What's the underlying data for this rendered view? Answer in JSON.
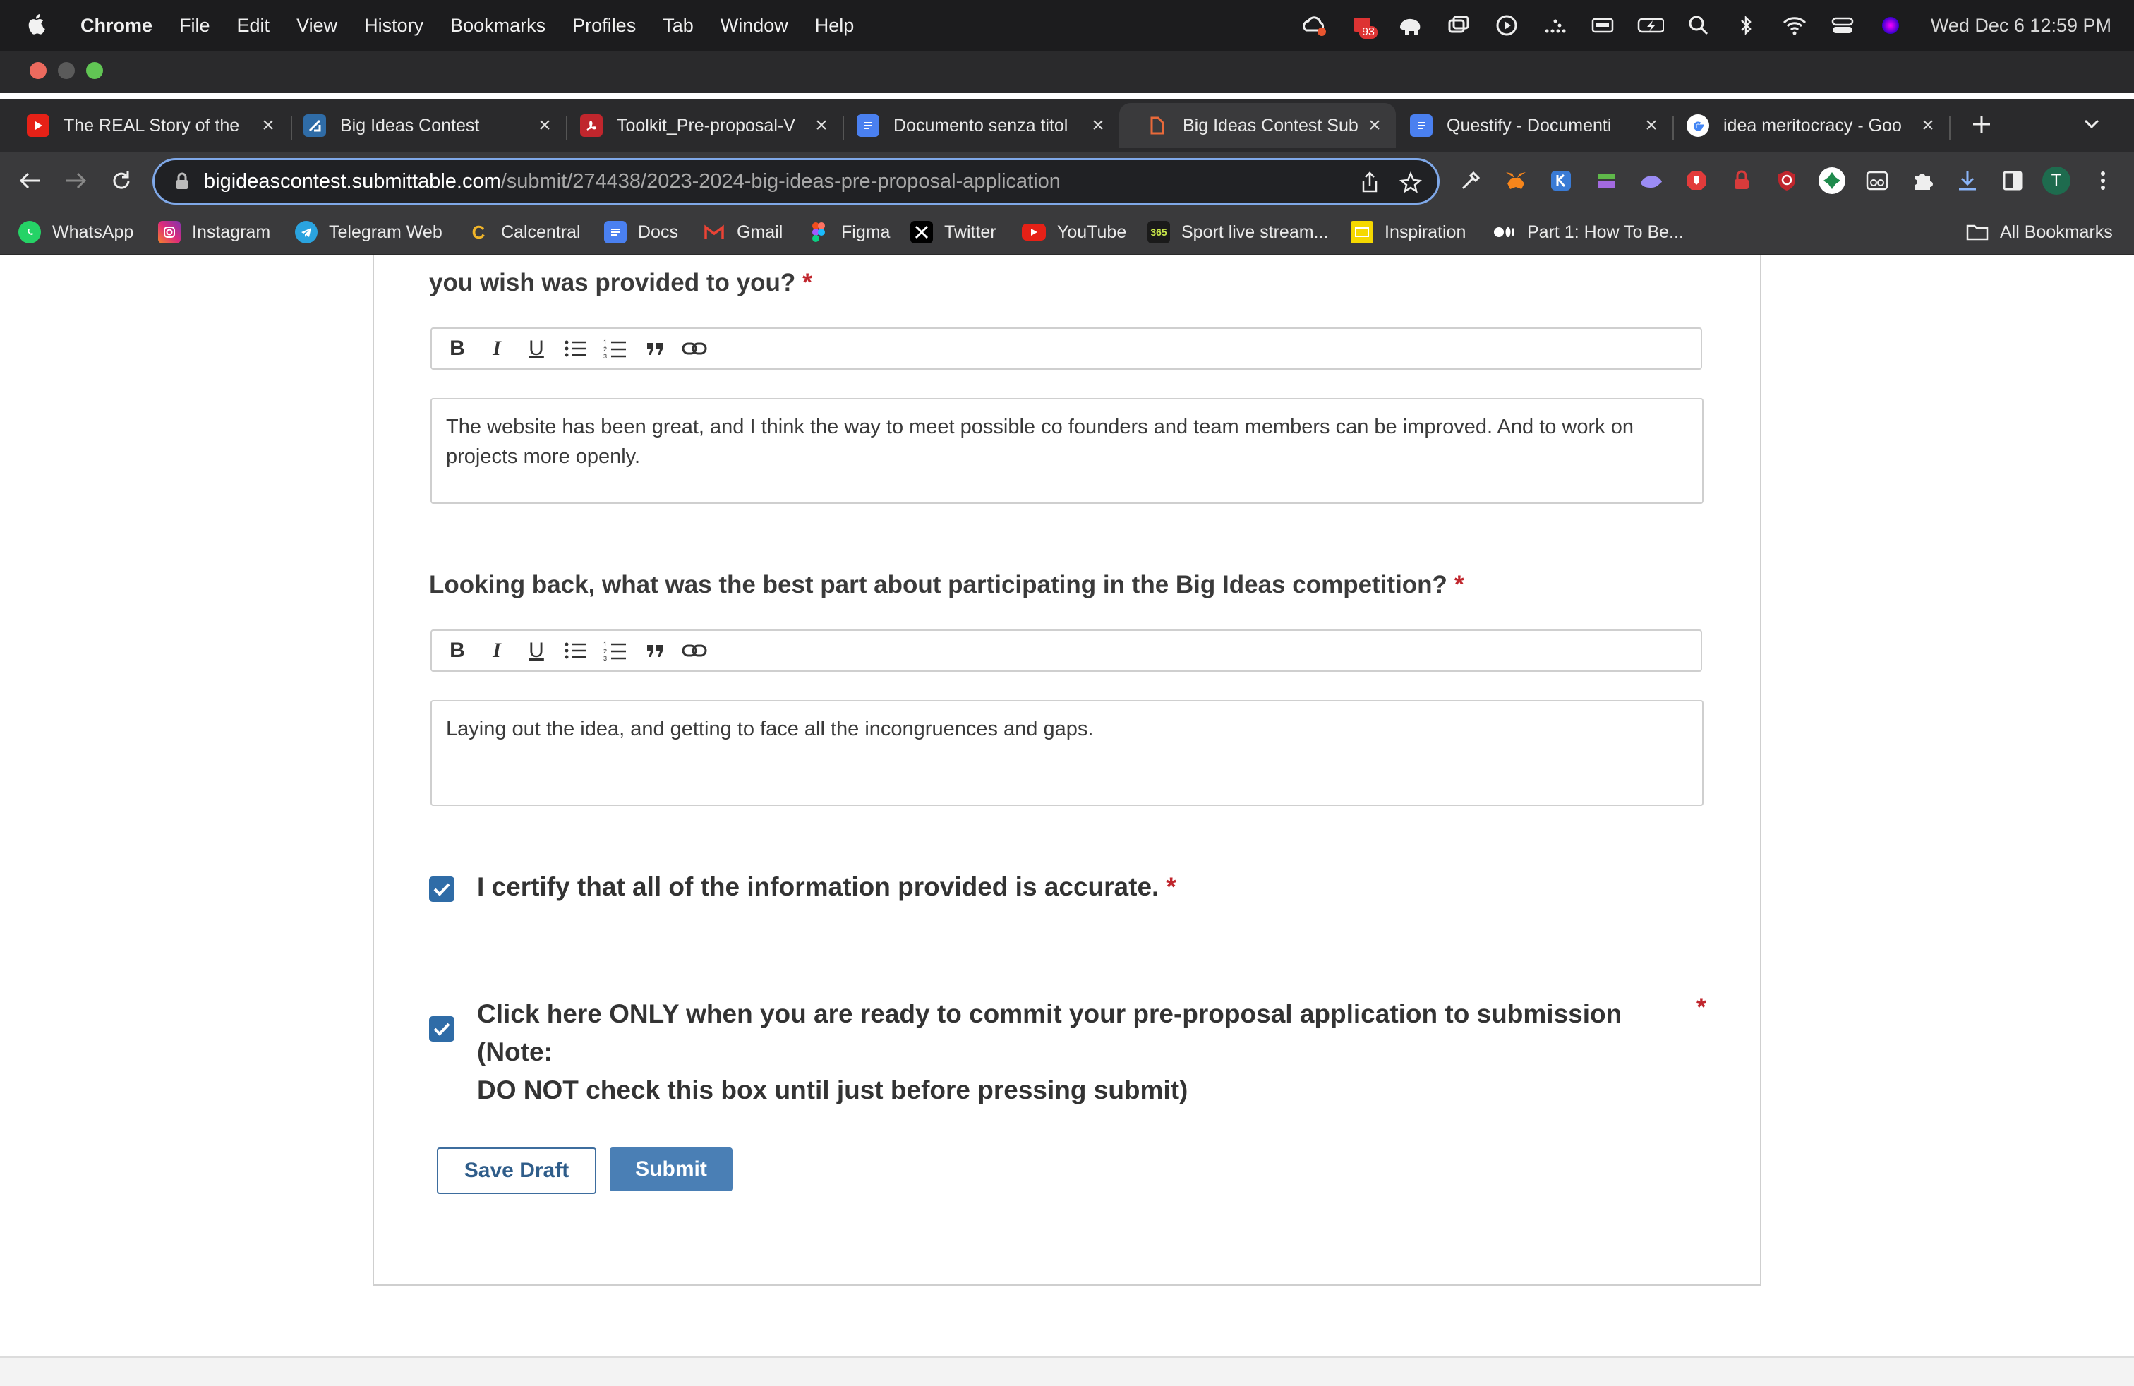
{
  "menubar": {
    "app_name": "Chrome",
    "menus": [
      "File",
      "Edit",
      "View",
      "History",
      "Bookmarks",
      "Profiles",
      "Tab",
      "Window",
      "Help"
    ],
    "battery_badge": "93",
    "clock": "Wed Dec 6  12:59 PM"
  },
  "tabs": [
    {
      "title": "The REAL Story of the",
      "icon": "youtube-icon",
      "color": "#e62117"
    },
    {
      "title": "Big Ideas Contest",
      "icon": "bigideas-icon",
      "color": "#2f6ca7"
    },
    {
      "title": "Toolkit_Pre-proposal-V",
      "icon": "pdf-icon",
      "color": "#c0262d"
    },
    {
      "title": "Documento senza titol",
      "icon": "docs-icon",
      "color": "#4a80f0"
    },
    {
      "title": "Big Ideas Contest Sub",
      "icon": "submittable-icon",
      "color": "#e8693a",
      "active": true
    },
    {
      "title": "Questify - Documenti",
      "icon": "docs-icon",
      "color": "#4a80f0"
    },
    {
      "title": "idea meritocracy - Goo",
      "icon": "google-icon",
      "color": "#ffffff"
    }
  ],
  "address_bar": {
    "host": "bigideascontest.submittable.com",
    "path": "/submit/274438/2023-2024-big-ideas-pre-proposal-application"
  },
  "profile_initial": "T",
  "bookmarks": [
    {
      "label": "WhatsApp",
      "icon": "whatsapp-icon",
      "color": "#25d366"
    },
    {
      "label": "Instagram",
      "icon": "instagram-icon",
      "color": "#d6249f"
    },
    {
      "label": "Telegram Web",
      "icon": "telegram-icon",
      "color": "#2aa3df"
    },
    {
      "label": "Calcentral",
      "icon": "calcentral-icon",
      "color": "#f0b429"
    },
    {
      "label": "Docs",
      "icon": "docs-icon",
      "color": "#4a80f0"
    },
    {
      "label": "Gmail",
      "icon": "gmail-icon",
      "color": "#ea4335"
    },
    {
      "label": "Figma",
      "icon": "figma-icon",
      "color": "#a259ff"
    },
    {
      "label": "Twitter",
      "icon": "x-icon",
      "color": "#000000"
    },
    {
      "label": "YouTube",
      "icon": "youtube-icon",
      "color": "#e62117"
    },
    {
      "label": "Sport live stream...",
      "icon": "sport-icon",
      "color": "#1a1a1a",
      "icon_text": "365"
    },
    {
      "label": "Inspiration",
      "icon": "inspiration-icon",
      "color": "#f5d800"
    },
    {
      "label": "Part 1: How To Be...",
      "icon": "medium-icon",
      "color": "#000000"
    }
  ],
  "all_bookmarks_label": "All Bookmarks",
  "form": {
    "q1_label": "you wish was provided to you?",
    "q1_answer": "The website has been great, and I think the way to meet possible co founders and team members can be improved. And to work on projects more openly.",
    "q2_label": "Looking back, what was the best part about participating in the Big Ideas competition?",
    "q2_answer": "Laying out the idea, and getting to face all the incongruences and gaps.",
    "certify_label": "I certify that all of the information provided is accurate.",
    "certify_checked": true,
    "commit_label_line1": "Click here ONLY when you are ready to commit your pre-proposal application to submission (Note:",
    "commit_label_line2": "DO NOT check this box until just before pressing submit)",
    "commit_checked": true,
    "required_mark": "*",
    "save_draft_label": "Save Draft",
    "submit_label": "Submit"
  },
  "colors": {
    "accent_blue": "#2f6ca7",
    "submit_button": "#4a7fb5",
    "required_red": "#c0262d"
  }
}
